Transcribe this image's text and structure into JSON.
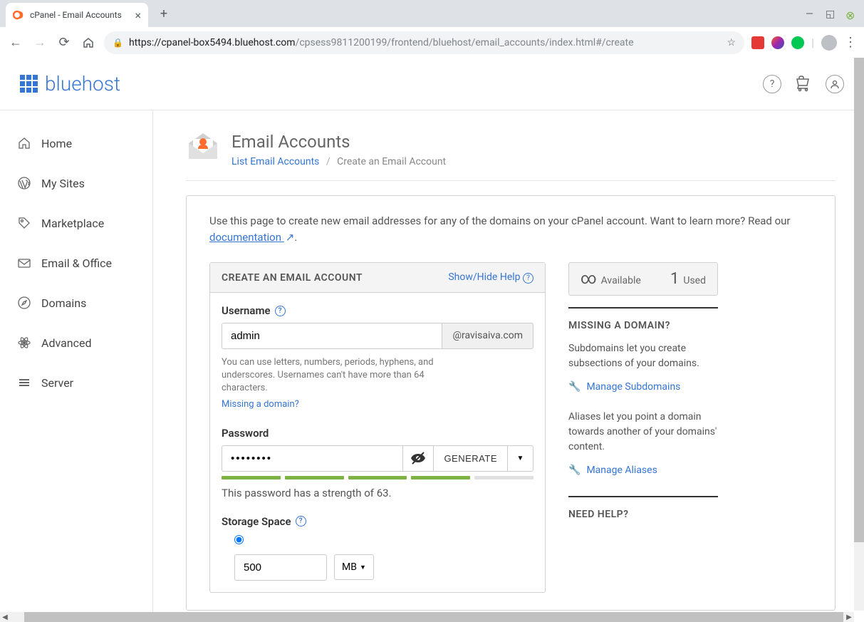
{
  "browser": {
    "tab_title": "cPanel - Email Accounts",
    "url_host": "https://cpanel-box5494.bluehost.com",
    "url_path": "/cpsess9811200199/frontend/bluehost/email_accounts/index.html#/create"
  },
  "logo_text": "bluehost",
  "sidebar": {
    "items": [
      {
        "label": "Home"
      },
      {
        "label": "My Sites"
      },
      {
        "label": "Marketplace"
      },
      {
        "label": "Email & Office"
      },
      {
        "label": "Domains"
      },
      {
        "label": "Advanced"
      },
      {
        "label": "Server"
      }
    ]
  },
  "header": {
    "title": "Email Accounts",
    "crumb_link": "List Email Accounts",
    "crumb_current": "Create an Email Account"
  },
  "intro": {
    "text_before": "Use this page to create new email addresses for any of the domains on your cPanel account. Want to learn more? Read our ",
    "link": "documentation",
    "text_after": "."
  },
  "form": {
    "card_title": "CREATE AN EMAIL ACCOUNT",
    "help_toggle": "Show/Hide Help",
    "username_label": "Username",
    "username_value": "admin",
    "domain": "@ravisaiva.com",
    "username_hint": "You can use letters, numbers, periods, hyphens, and underscores. Usernames can't have more than 64 characters.",
    "missing_domain_link": "Missing a domain?",
    "password_label": "Password",
    "password_value": "••••••••",
    "generate_label": "GENERATE",
    "strength_value": "63",
    "strength_text_before": "This password has a strength of ",
    "strength_text_after": ".",
    "storage_label": "Storage Space",
    "storage_value": "500",
    "storage_unit": "MB"
  },
  "stats": {
    "available_label": "Available",
    "used_value": "1",
    "used_label": "Used"
  },
  "side": {
    "missing_title": "MISSING A DOMAIN?",
    "subdomain_text": "Subdomains let you create subsections of your domains.",
    "subdomain_link": "Manage Subdomains",
    "alias_text": "Aliases let you point a domain towards another of your domains' content.",
    "alias_link": "Manage Aliases",
    "help_title": "NEED HELP?"
  }
}
